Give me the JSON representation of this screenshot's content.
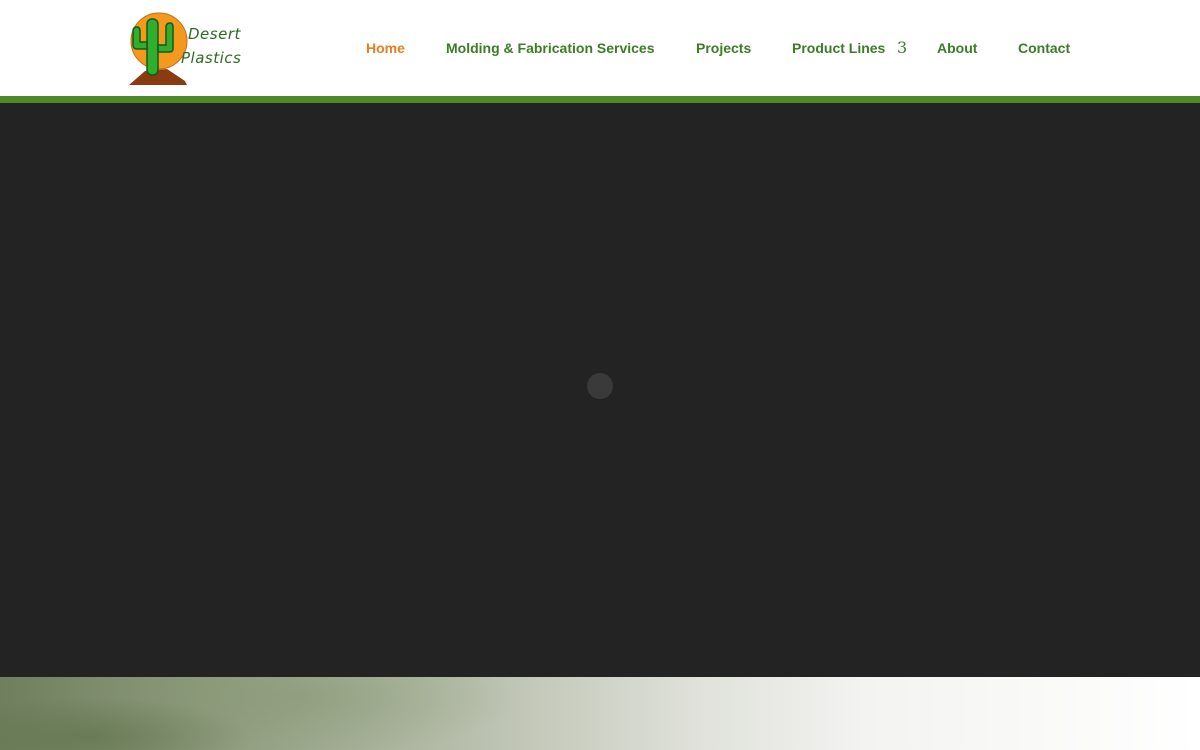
{
  "brand": {
    "name_line1": "Desert",
    "name_line2": "Plastics",
    "icon": "cactus-sun-logo"
  },
  "nav": {
    "items": [
      {
        "label": "Home",
        "active": true
      },
      {
        "label": "Molding & Fabrication Services",
        "active": false
      },
      {
        "label": "Projects",
        "active": false
      },
      {
        "label": "Product Lines",
        "active": false
      },
      {
        "label": "About",
        "active": false
      },
      {
        "label": "Contact",
        "active": false
      }
    ],
    "dropdown_glyph": "3"
  },
  "colors": {
    "nav_text": "#3a7d26",
    "nav_active": "#e67e22",
    "accent_bar": "#4c8a26",
    "hero_bg": "#232323"
  }
}
